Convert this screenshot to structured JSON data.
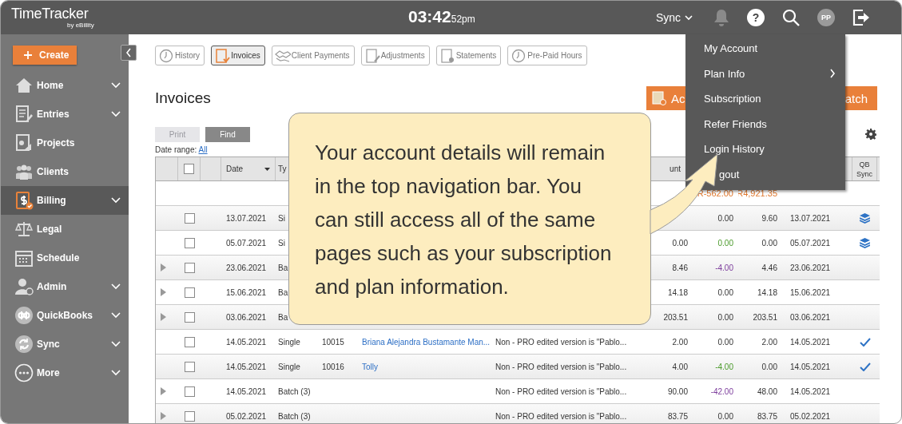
{
  "app": {
    "logo": "TimeTracker",
    "logo_sub": "by eBillity"
  },
  "topbar": {
    "time": "03:42",
    "time_suffix": "52pm",
    "sync_label": "Sync",
    "help": "?",
    "avatar": "PP"
  },
  "sidebar": {
    "create": "Create",
    "items": [
      {
        "label": "Home",
        "kind": "home",
        "expandable": true,
        "selected": false
      },
      {
        "label": "Entries",
        "kind": "entries",
        "expandable": true,
        "selected": false
      },
      {
        "label": "Projects",
        "kind": "projects",
        "expandable": false,
        "selected": false
      },
      {
        "label": "Clients",
        "kind": "clients",
        "expandable": false,
        "selected": false
      },
      {
        "label": "Billing",
        "kind": "billing",
        "expandable": true,
        "selected": true
      },
      {
        "label": "Legal",
        "kind": "legal",
        "expandable": false,
        "selected": false
      },
      {
        "label": "Schedule",
        "kind": "schedule",
        "expandable": false,
        "selected": false
      },
      {
        "label": "Admin",
        "kind": "admin",
        "expandable": true,
        "selected": false
      },
      {
        "label": "QuickBooks",
        "kind": "quickbooks",
        "expandable": true,
        "selected": false
      },
      {
        "label": "Sync",
        "kind": "sync",
        "expandable": true,
        "selected": false
      },
      {
        "label": "More",
        "kind": "more",
        "expandable": true,
        "selected": false
      }
    ]
  },
  "tabs": [
    {
      "label": "History",
      "kind": "history",
      "selected": false
    },
    {
      "label": "Invoices",
      "kind": "invoice",
      "selected": true
    },
    {
      "label": "Client Payments",
      "kind": "payments",
      "selected": false
    },
    {
      "label": "Adjustments",
      "kind": "adjust",
      "selected": false
    },
    {
      "label": "Statements",
      "kind": "statement",
      "selected": false
    },
    {
      "label": "Pre-Paid Hours",
      "kind": "history",
      "selected": false
    }
  ],
  "page": {
    "title": "Invoices",
    "print": {
      "label": "Print",
      "disabled": true
    },
    "find": "Find",
    "date_range_label": "Date range:",
    "date_range_link": "All",
    "action_buttons": [
      "Ac",
      "atch"
    ]
  },
  "table": {
    "headers": {
      "all_checked": false,
      "date": "Date",
      "date_sorted": true,
      "type": "Ty",
      "amount": "unt",
      "qb_sync": "QB Sync"
    },
    "totals": {
      "discount": "R-562.00",
      "balance": "R4,921.35"
    },
    "rows": [
      {
        "expandable": false,
        "checked": false,
        "date": "13.07.2021",
        "type": "Si",
        "discount": {
          "text": "0.00",
          "kind": "plain"
        },
        "balance": "9.60",
        "due": "13.07.2021",
        "qb_sync": {
          "kind": "stack"
        }
      },
      {
        "expandable": false,
        "checked": false,
        "date": "05.07.2021",
        "type": "Si",
        "amount": "0.00",
        "discount": {
          "text": "0.00",
          "kind": "credit"
        },
        "balance": "0.00",
        "due": "05.07.2021",
        "qb_sync": {
          "kind": "stack"
        }
      },
      {
        "expandable": true,
        "checked": false,
        "date": "23.06.2021",
        "type": "Ba",
        "amount": "8.46",
        "discount": {
          "text": "-4.00",
          "kind": "debit"
        },
        "balance": "4.46",
        "due": "23.06.2021"
      },
      {
        "expandable": true,
        "checked": false,
        "date": "15.06.2021",
        "type": "Ba",
        "amount": "14.18",
        "discount": {
          "text": "0.00",
          "kind": "plain"
        },
        "balance": "14.18",
        "due": "15.06.2021"
      },
      {
        "expandable": true,
        "checked": false,
        "date": "03.06.2021",
        "type": "Ba",
        "amount": "203.51",
        "discount": {
          "text": "0.00",
          "kind": "plain"
        },
        "balance": "203.51",
        "due": "03.06.2021"
      },
      {
        "expandable": false,
        "checked": false,
        "date": "14.05.2021",
        "type": "Single",
        "number": "10015",
        "client": "Briana Alejandra Bustamante Man...",
        "description": "Non - PRO edited version is \"Pablo...",
        "amount": "2.00",
        "discount": {
          "text": "0.00",
          "kind": "plain"
        },
        "balance": "2.00",
        "due": "14.05.2021",
        "qb_sync": {
          "kind": "check"
        }
      },
      {
        "expandable": false,
        "checked": false,
        "date": "14.05.2021",
        "type": "Single",
        "number": "10016",
        "client": "Tolly",
        "description": "Non - PRO edited version is \"Pablo...",
        "amount": "4.00",
        "discount": {
          "text": "-4.00",
          "kind": "credit"
        },
        "balance": "0.00",
        "due": "14.05.2021",
        "qb_sync": {
          "kind": "check"
        }
      },
      {
        "expandable": true,
        "checked": false,
        "date": "14.05.2021",
        "type": "Batch (3)",
        "description": "Non - PRO edited version is \"Pablo...",
        "amount": "90.00",
        "discount": {
          "text": "-42.00",
          "kind": "debit"
        },
        "balance": "48.00",
        "due": "14.05.2021"
      },
      {
        "expandable": true,
        "checked": false,
        "date": "05.02.2021",
        "type": "Batch (3)",
        "description": "Non - PRO edited version is \"Pablo...",
        "amount": "83.75",
        "discount": {
          "text": "0.00",
          "kind": "plain"
        },
        "balance": "83.75",
        "due": "05.02.2021"
      }
    ]
  },
  "account_menu": {
    "items": [
      {
        "label": "My Account",
        "submenu": false
      },
      {
        "label": "Plan Info",
        "submenu": true
      },
      {
        "label": "Subscription",
        "submenu": false
      },
      {
        "label": "Refer Friends",
        "submenu": false
      },
      {
        "label": "Login History",
        "submenu": false
      },
      {
        "label": "gout",
        "submenu": false
      }
    ]
  },
  "callout": {
    "text": "Your account details will remain in the top navigation bar. You can still access all of the same pages such as your subscription and plan information."
  }
}
